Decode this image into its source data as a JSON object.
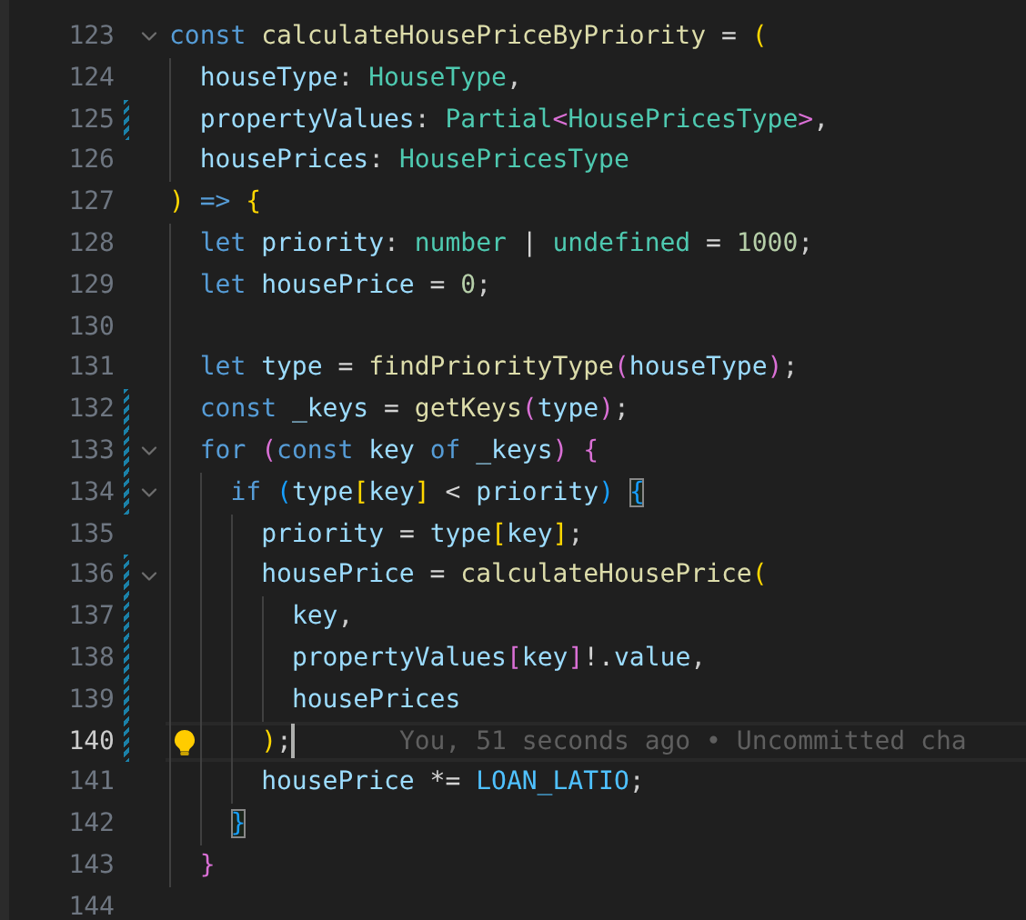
{
  "editor": {
    "lines": [
      {
        "number": "123",
        "modified": false,
        "foldable": true,
        "current": false,
        "lightbulb": false,
        "tokens": [
          {
            "text": "const ",
            "kind": "keyword"
          },
          {
            "text": "calculateHousePriceByPriority",
            "kind": "function"
          },
          {
            "text": " = ",
            "kind": "operator"
          },
          {
            "text": "(",
            "kind": "bracket1"
          }
        ]
      },
      {
        "number": "124",
        "modified": false,
        "foldable": false,
        "current": false,
        "lightbulb": false,
        "tokens": [
          {
            "text": "  houseType",
            "kind": "variable"
          },
          {
            "text": ": ",
            "kind": "punct"
          },
          {
            "text": "HouseType",
            "kind": "type"
          },
          {
            "text": ",",
            "kind": "punct"
          }
        ]
      },
      {
        "number": "125",
        "modified": true,
        "foldable": false,
        "current": false,
        "lightbulb": false,
        "tokens": [
          {
            "text": "  propertyValues",
            "kind": "variable"
          },
          {
            "text": ": ",
            "kind": "punct"
          },
          {
            "text": "Partial",
            "kind": "type"
          },
          {
            "text": "<",
            "kind": "bracket2"
          },
          {
            "text": "HousePricesType",
            "kind": "type"
          },
          {
            "text": ">",
            "kind": "bracket2"
          },
          {
            "text": ",",
            "kind": "punct"
          }
        ]
      },
      {
        "number": "126",
        "modified": false,
        "foldable": false,
        "current": false,
        "lightbulb": false,
        "tokens": [
          {
            "text": "  housePrices",
            "kind": "variable"
          },
          {
            "text": ": ",
            "kind": "punct"
          },
          {
            "text": "HousePricesType",
            "kind": "type"
          }
        ]
      },
      {
        "number": "127",
        "modified": false,
        "foldable": false,
        "current": false,
        "lightbulb": false,
        "tokens": [
          {
            "text": ")",
            "kind": "bracket1"
          },
          {
            "text": " => ",
            "kind": "keyword"
          },
          {
            "text": "{",
            "kind": "bracket1"
          }
        ]
      },
      {
        "number": "128",
        "modified": false,
        "foldable": false,
        "current": false,
        "lightbulb": false,
        "tokens": [
          {
            "text": "  let ",
            "kind": "keyword"
          },
          {
            "text": "priority",
            "kind": "variable"
          },
          {
            "text": ": ",
            "kind": "punct"
          },
          {
            "text": "number",
            "kind": "type"
          },
          {
            "text": " | ",
            "kind": "operator"
          },
          {
            "text": "undefined",
            "kind": "type"
          },
          {
            "text": " = ",
            "kind": "operator"
          },
          {
            "text": "1000",
            "kind": "number"
          },
          {
            "text": ";",
            "kind": "punct"
          }
        ]
      },
      {
        "number": "129",
        "modified": false,
        "foldable": false,
        "current": false,
        "lightbulb": false,
        "tokens": [
          {
            "text": "  let ",
            "kind": "keyword"
          },
          {
            "text": "housePrice",
            "kind": "variable"
          },
          {
            "text": " = ",
            "kind": "operator"
          },
          {
            "text": "0",
            "kind": "number"
          },
          {
            "text": ";",
            "kind": "punct"
          }
        ]
      },
      {
        "number": "130",
        "modified": false,
        "foldable": false,
        "current": false,
        "lightbulb": false
      },
      {
        "number": "131",
        "modified": false,
        "foldable": false,
        "current": false,
        "lightbulb": false,
        "tokens": [
          {
            "text": "  let ",
            "kind": "keyword"
          },
          {
            "text": "type",
            "kind": "variable"
          },
          {
            "text": " = ",
            "kind": "operator"
          },
          {
            "text": "findPriorityType",
            "kind": "function"
          },
          {
            "text": "(",
            "kind": "bracket2"
          },
          {
            "text": "houseType",
            "kind": "variable"
          },
          {
            "text": ")",
            "kind": "bracket2"
          },
          {
            "text": ";",
            "kind": "punct"
          }
        ]
      },
      {
        "number": "132",
        "modified": true,
        "foldable": false,
        "current": false,
        "lightbulb": false,
        "tokens": [
          {
            "text": "  const ",
            "kind": "keyword"
          },
          {
            "text": "_keys",
            "kind": "variable"
          },
          {
            "text": " = ",
            "kind": "operator"
          },
          {
            "text": "getKeys",
            "kind": "function"
          },
          {
            "text": "(",
            "kind": "bracket2"
          },
          {
            "text": "type",
            "kind": "variable"
          },
          {
            "text": ")",
            "kind": "bracket2"
          },
          {
            "text": ";",
            "kind": "punct"
          }
        ]
      },
      {
        "number": "133",
        "modified": true,
        "foldable": true,
        "current": false,
        "lightbulb": false,
        "tokens": [
          {
            "text": "  for ",
            "kind": "keyword"
          },
          {
            "text": "(",
            "kind": "bracket2"
          },
          {
            "text": "const ",
            "kind": "keyword"
          },
          {
            "text": "key ",
            "kind": "variable"
          },
          {
            "text": "of ",
            "kind": "keyword"
          },
          {
            "text": "_keys",
            "kind": "variable"
          },
          {
            "text": ") ",
            "kind": "bracket2"
          },
          {
            "text": "{",
            "kind": "bracket2"
          }
        ]
      },
      {
        "number": "134",
        "modified": true,
        "foldable": true,
        "current": false,
        "lightbulb": false,
        "tokens": [
          {
            "text": "    if ",
            "kind": "keyword"
          },
          {
            "text": "(",
            "kind": "bracket3"
          },
          {
            "text": "type",
            "kind": "variable"
          },
          {
            "text": "[",
            "kind": "bracket1"
          },
          {
            "text": "key",
            "kind": "variable"
          },
          {
            "text": "]",
            "kind": "bracket1"
          },
          {
            "text": " < ",
            "kind": "operator"
          },
          {
            "text": "priority",
            "kind": "variable"
          },
          {
            "text": ") ",
            "kind": "bracket3"
          },
          {
            "text": "{",
            "kind": "bracket3",
            "matched": true
          }
        ]
      },
      {
        "number": "135",
        "modified": false,
        "foldable": false,
        "current": false,
        "lightbulb": false,
        "tokens": [
          {
            "text": "      priority",
            "kind": "variable"
          },
          {
            "text": " = ",
            "kind": "operator"
          },
          {
            "text": "type",
            "kind": "variable"
          },
          {
            "text": "[",
            "kind": "bracket1"
          },
          {
            "text": "key",
            "kind": "variable"
          },
          {
            "text": "]",
            "kind": "bracket1"
          },
          {
            "text": ";",
            "kind": "punct"
          }
        ]
      },
      {
        "number": "136",
        "modified": true,
        "foldable": true,
        "current": false,
        "lightbulb": false,
        "tokens": [
          {
            "text": "      housePrice",
            "kind": "variable"
          },
          {
            "text": " = ",
            "kind": "operator"
          },
          {
            "text": "calculateHousePrice",
            "kind": "function"
          },
          {
            "text": "(",
            "kind": "bracket1"
          }
        ]
      },
      {
        "number": "137",
        "modified": true,
        "foldable": false,
        "current": false,
        "lightbulb": false,
        "tokens": [
          {
            "text": "        key",
            "kind": "variable"
          },
          {
            "text": ",",
            "kind": "punct"
          }
        ]
      },
      {
        "number": "138",
        "modified": true,
        "foldable": false,
        "current": false,
        "lightbulb": false,
        "tokens": [
          {
            "text": "        propertyValues",
            "kind": "variable"
          },
          {
            "text": "[",
            "kind": "bracket2"
          },
          {
            "text": "key",
            "kind": "variable"
          },
          {
            "text": "]",
            "kind": "bracket2"
          },
          {
            "text": "!.",
            "kind": "operator"
          },
          {
            "text": "value",
            "kind": "variable"
          },
          {
            "text": ",",
            "kind": "punct"
          }
        ]
      },
      {
        "number": "139",
        "modified": true,
        "foldable": false,
        "current": false,
        "lightbulb": false,
        "tokens": [
          {
            "text": "        housePrices",
            "kind": "variable"
          }
        ]
      },
      {
        "number": "140",
        "modified": true,
        "foldable": false,
        "current": true,
        "lightbulb": true,
        "blame": "You, 51 seconds ago • Uncommitted cha",
        "tokens": [
          {
            "text": "      )",
            "kind": "bracket1"
          },
          {
            "text": ";",
            "kind": "punct"
          }
        ]
      },
      {
        "number": "141",
        "modified": false,
        "foldable": false,
        "current": false,
        "lightbulb": false,
        "tokens": [
          {
            "text": "      housePrice",
            "kind": "variable"
          },
          {
            "text": " *= ",
            "kind": "operator"
          },
          {
            "text": "LOAN_LATIO",
            "kind": "constant"
          },
          {
            "text": ";",
            "kind": "punct"
          }
        ]
      },
      {
        "number": "142",
        "modified": false,
        "foldable": false,
        "current": false,
        "lightbulb": false,
        "tokens": [
          {
            "text": "    }",
            "kind": "bracket3",
            "matched": true
          }
        ]
      },
      {
        "number": "143",
        "modified": false,
        "foldable": false,
        "current": false,
        "lightbulb": false,
        "tokens": [
          {
            "text": "  }",
            "kind": "bracket2"
          }
        ]
      },
      {
        "number": "144",
        "modified": false,
        "foldable": false,
        "current": false,
        "lightbulb": false
      }
    ]
  }
}
